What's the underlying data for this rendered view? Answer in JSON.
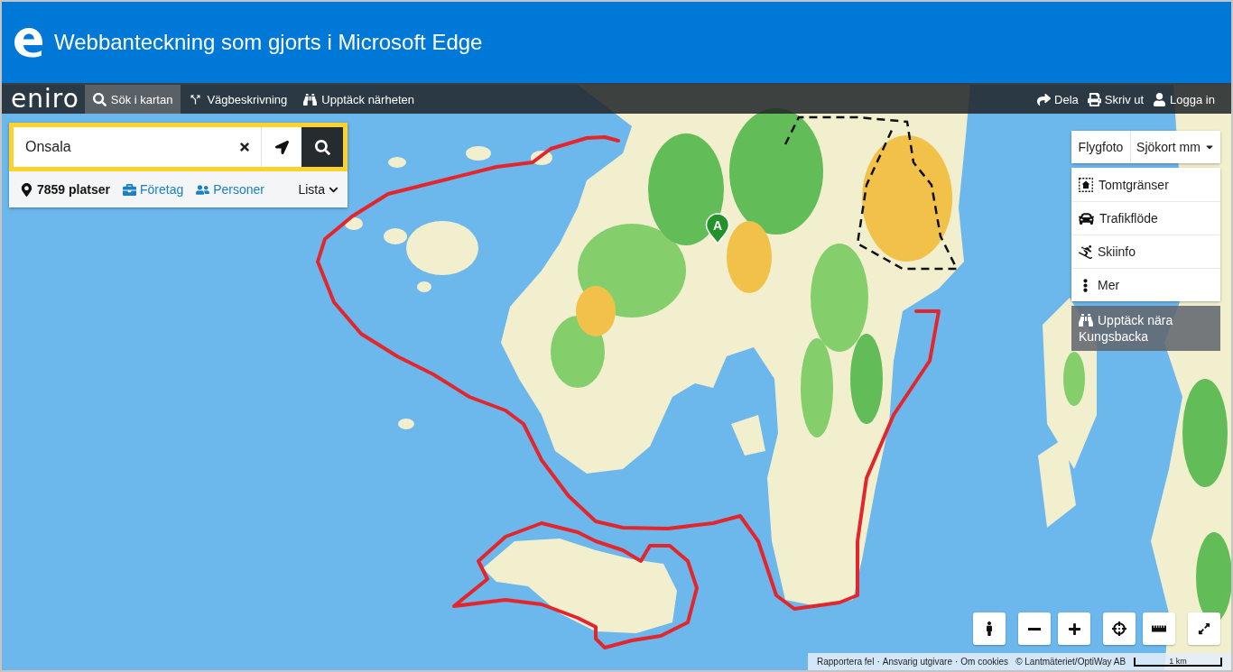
{
  "window": {
    "title": "Webbanteckning som gjorts i Microsoft Edge"
  },
  "nav": {
    "logo": "eniro",
    "items": [
      {
        "label": "Sök i kartan",
        "selected": true
      },
      {
        "label": "Vägbeskrivning",
        "selected": false
      },
      {
        "label": "Upptäck närheten",
        "selected": false
      }
    ],
    "actions": [
      {
        "label": "Dela"
      },
      {
        "label": "Skriv ut"
      },
      {
        "label": "Logga in"
      }
    ]
  },
  "search": {
    "value": "Onsala",
    "result_count": "7859 platser",
    "filters": [
      {
        "label": "Företag"
      },
      {
        "label": "Personer"
      }
    ],
    "view": "Lista"
  },
  "map_type_buttons": [
    {
      "label": "Flygfoto"
    }
  ],
  "map_type_dropdown": {
    "label": "Sjökort mm",
    "expanded": true,
    "items": [
      {
        "label": "Tomtgränser"
      },
      {
        "label": "Trafikflöde"
      },
      {
        "label": "Skiinfo"
      },
      {
        "label": "Mer"
      }
    ]
  },
  "discover": {
    "label": "Upptäck nära Kungsbacka"
  },
  "map": {
    "marker": {
      "label": "A"
    }
  },
  "footer": {
    "links": [
      "Rapportera fel",
      "Ansvarig utgivare",
      "Om cookies"
    ],
    "separator": "·",
    "copyright": "© Lantmäteriet/OptiWay AB",
    "scale": "1 km"
  }
}
